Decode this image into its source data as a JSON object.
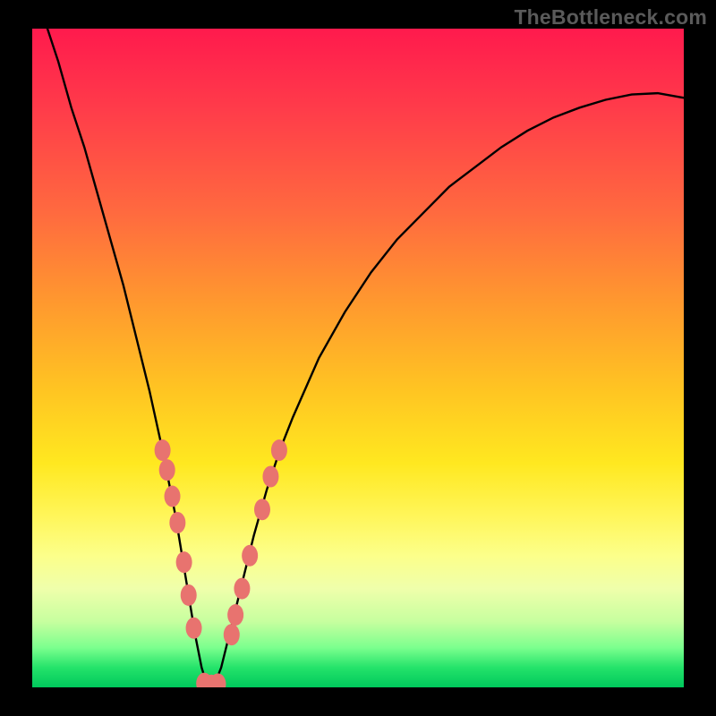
{
  "watermark": "TheBottleneck.com",
  "chart_data": {
    "type": "line",
    "title": "",
    "xlabel": "",
    "ylabel": "",
    "xlim": [
      0,
      100
    ],
    "ylim": [
      0,
      100
    ],
    "grid": false,
    "series": [
      {
        "name": "curve",
        "x": [
          0,
          2,
          4,
          6,
          8,
          10,
          12,
          14,
          16,
          18,
          20,
          21,
          22,
          23,
          24,
          25,
          26,
          26.8,
          27.5,
          28,
          29,
          30,
          31,
          32,
          33,
          34,
          36,
          38,
          40,
          44,
          48,
          52,
          56,
          60,
          64,
          68,
          72,
          76,
          80,
          84,
          88,
          92,
          96,
          100
        ],
        "y": [
          107,
          101,
          95,
          88,
          82,
          75,
          68,
          61,
          53,
          45,
          36,
          31,
          26,
          20,
          14,
          8,
          3,
          0.5,
          0,
          0.5,
          3,
          7,
          11,
          15,
          19,
          23,
          30,
          36,
          41,
          50,
          57,
          63,
          68,
          72,
          76,
          79,
          82,
          84.5,
          86.5,
          88,
          89.2,
          90,
          90.2,
          89.5
        ],
        "color": "#000000"
      }
    ],
    "markers": {
      "name": "highlight-points",
      "color": "#e8736f",
      "points": [
        {
          "x": 20.0,
          "y": 36
        },
        {
          "x": 20.7,
          "y": 33
        },
        {
          "x": 21.5,
          "y": 29
        },
        {
          "x": 22.3,
          "y": 25
        },
        {
          "x": 23.3,
          "y": 19
        },
        {
          "x": 24.0,
          "y": 14
        },
        {
          "x": 24.8,
          "y": 9
        },
        {
          "x": 26.4,
          "y": 0.6
        },
        {
          "x": 27.5,
          "y": 0.3
        },
        {
          "x": 28.5,
          "y": 0.5
        },
        {
          "x": 30.6,
          "y": 8
        },
        {
          "x": 31.2,
          "y": 11
        },
        {
          "x": 32.2,
          "y": 15
        },
        {
          "x": 33.4,
          "y": 20
        },
        {
          "x": 35.3,
          "y": 27
        },
        {
          "x": 36.6,
          "y": 32
        },
        {
          "x": 37.9,
          "y": 36
        }
      ]
    }
  }
}
